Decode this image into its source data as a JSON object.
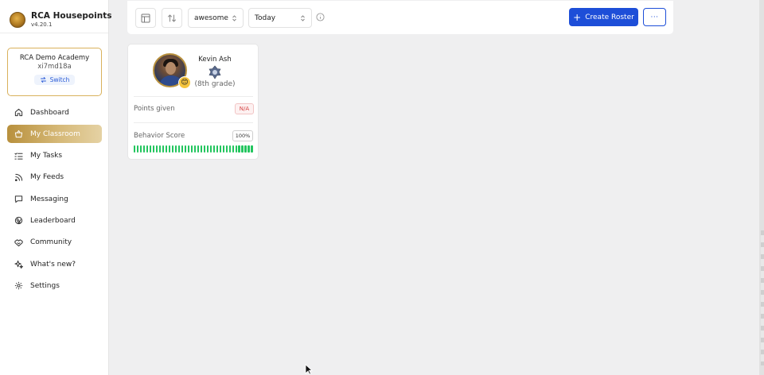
{
  "app": {
    "title": "RCA Housepoints",
    "version": "v4.20.1"
  },
  "school": {
    "name": "RCA Demo Academy",
    "code": "xi7md18a",
    "switch_label": "Switch"
  },
  "nav": [
    {
      "label": "Dashboard",
      "icon": "home-icon",
      "active": false
    },
    {
      "label": "My Classroom",
      "icon": "basket-icon",
      "active": true
    },
    {
      "label": "My Tasks",
      "icon": "task-list-icon",
      "active": false
    },
    {
      "label": "My Feeds",
      "icon": "rss-icon",
      "active": false
    },
    {
      "label": "Messaging",
      "icon": "message-icon",
      "active": false
    },
    {
      "label": "Leaderboard",
      "icon": "trophy-icon",
      "active": false
    },
    {
      "label": "Community",
      "icon": "handshake-icon",
      "active": false
    },
    {
      "label": "What's new?",
      "icon": "sparkles-icon",
      "active": false
    },
    {
      "label": "Settings",
      "icon": "gear-icon",
      "active": false
    }
  ],
  "toolbar": {
    "layout_icon": "layout-icon",
    "sort_icon": "sort-icon",
    "behavior_filter": "awesome",
    "date_filter": "Today",
    "info_icon": "info-icon",
    "create_label": "Create Roster",
    "more_label": "···"
  },
  "student": {
    "name": "Kevin Ash",
    "grade": "(8th grade)",
    "mood_emoji": "😊",
    "points_label": "Points given",
    "points_value": "N/A",
    "behavior_label": "Behavior Score",
    "behavior_value": "100%",
    "behavior_fraction": 1.0
  },
  "colors": {
    "accent_gold": "#b8903d",
    "primary_blue": "#1d4ed8",
    "score_green": "#22c55e",
    "na_red": "#d64545"
  }
}
